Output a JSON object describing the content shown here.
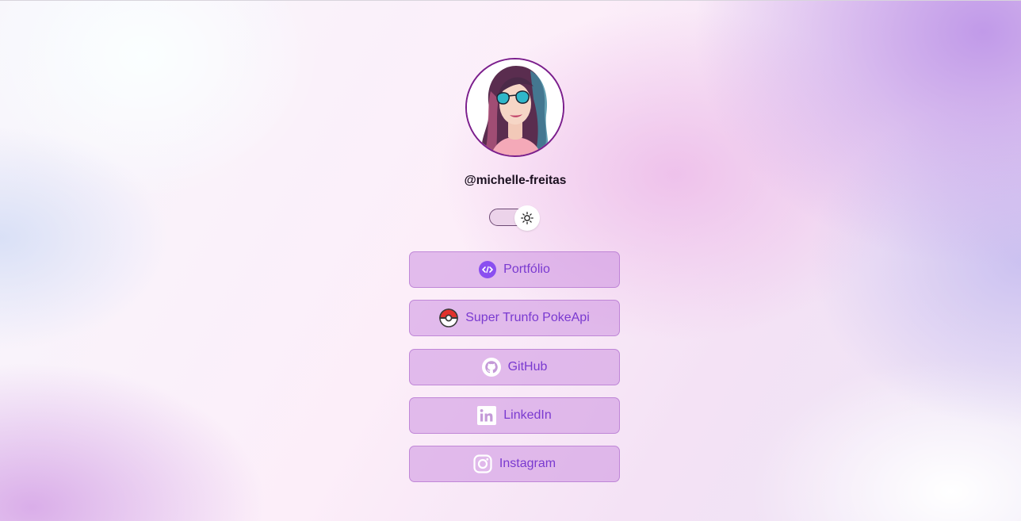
{
  "profile": {
    "username": "@michelle-freitas",
    "avatar_icon": "avatar-illustration"
  },
  "theme_toggle": {
    "state": "light",
    "icon": "sun-icon"
  },
  "links": [
    {
      "label": "Portfólio",
      "icon": "code-icon"
    },
    {
      "label": "Super Trunfo PokeApi",
      "icon": "pokeball-icon"
    },
    {
      "label": "GitHub",
      "icon": "github-icon"
    },
    {
      "label": "LinkedIn",
      "icon": "linkedin-icon"
    },
    {
      "label": "Instagram",
      "icon": "instagram-icon"
    }
  ],
  "colors": {
    "button_text": "#7a3ad0",
    "avatar_border": "#7b1e8c",
    "portfolio_icon": "#8a4ff0"
  }
}
